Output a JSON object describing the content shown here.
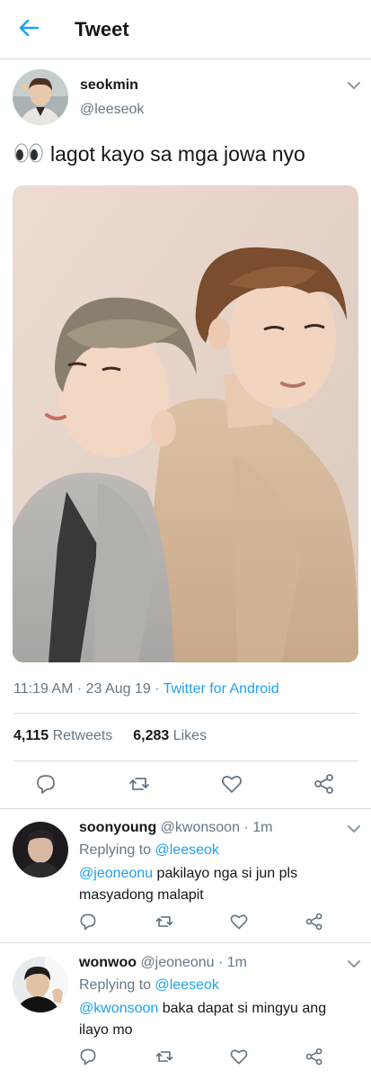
{
  "header": {
    "title": "Tweet"
  },
  "tweet": {
    "author_name": "seokmin",
    "author_handle": "@leeseok",
    "text": "lagot kayo sa mga jowa nyo",
    "time": "11:19 AM",
    "date": "23 Aug 19",
    "source": "Twitter for Android",
    "retweets_count": "4,115",
    "retweets_label": "Retweets",
    "likes_count": "6,283",
    "likes_label": "Likes"
  },
  "replies": [
    {
      "name": "soonyoung",
      "handle": "@kwonsoon",
      "time": "1m",
      "replying_label": "Replying to",
      "replying_to": "@leeseok",
      "mention": "@jeoneonu",
      "text": "pakilayo nga si jun pls masyadong malapit"
    },
    {
      "name": "wonwoo",
      "handle": "@jeoneonu",
      "time": "1m",
      "replying_label": "Replying to",
      "replying_to": "@leeseok",
      "mention": "@kwonsoon",
      "text": "baka dapat si mingyu ang ilayo mo"
    }
  ],
  "separator": "·",
  "colors": {
    "accent": "#1da1f2",
    "secondary_text": "#657786",
    "divider": "#d5dbe0"
  },
  "icons": [
    "back-arrow-icon",
    "chevron-down-icon",
    "eyes-emoji-icon",
    "reply-icon",
    "retweet-icon",
    "like-icon",
    "share-icon"
  ]
}
